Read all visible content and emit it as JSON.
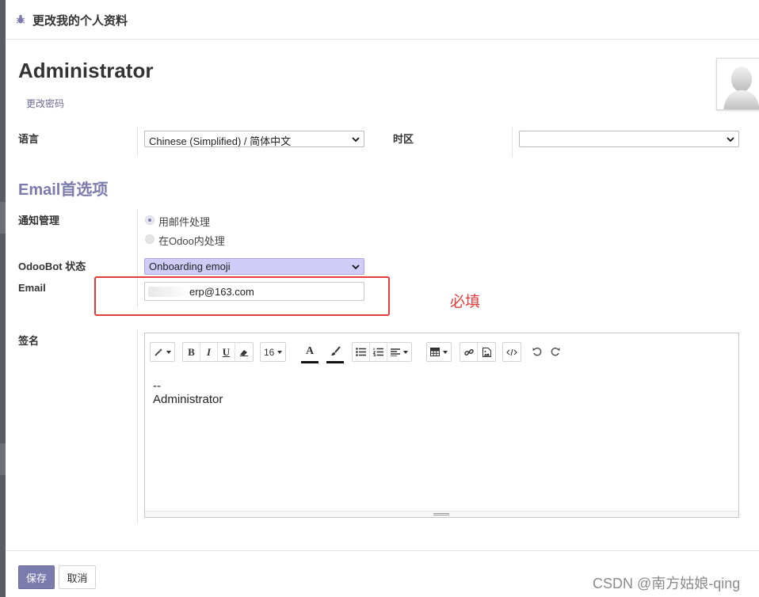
{
  "dialog": {
    "title": "更改我的个人资料",
    "icon": "bug-icon"
  },
  "user": {
    "name": "Administrator",
    "change_password": "更改密码",
    "avatar_icon": "default-avatar-icon"
  },
  "fields": {
    "language": {
      "label": "语言",
      "value": "Chinese (Simplified) / 简体中文"
    },
    "timezone": {
      "label": "时区",
      "value": ""
    }
  },
  "email_section": {
    "title": "Email首选项",
    "notification": {
      "label": "通知管理",
      "options": [
        {
          "label": "用邮件处理",
          "selected": true
        },
        {
          "label": "在Odoo内处理",
          "selected": false
        }
      ]
    },
    "odoobot": {
      "label": "OdooBot 状态",
      "value": "Onboarding emoji"
    },
    "email": {
      "label": "Email",
      "value": "erp@163.com"
    }
  },
  "annotation": {
    "text": "必填",
    "color": "#e53b3b"
  },
  "signature": {
    "label": "签名",
    "font_size": "16",
    "lines": [
      "--",
      "Administrator"
    ]
  },
  "toolbar_icons": [
    "magic-wand-icon",
    "bold-icon",
    "italic-icon",
    "underline-icon",
    "eraser-icon",
    "font-size-dropdown",
    "font-color-icon",
    "highlight-icon",
    "bullet-list-icon",
    "numbered-list-icon",
    "align-icon",
    "table-icon",
    "link-icon",
    "image-icon",
    "code-view-icon",
    "undo-icon",
    "redo-icon"
  ],
  "footer": {
    "save": "保存",
    "cancel": "取消"
  },
  "watermark": "CSDN @南方姑娘-qing",
  "colors": {
    "accent": "#7c7bad",
    "highlight_select": "#cfcdf7",
    "annotation_red": "#e53b3b"
  }
}
